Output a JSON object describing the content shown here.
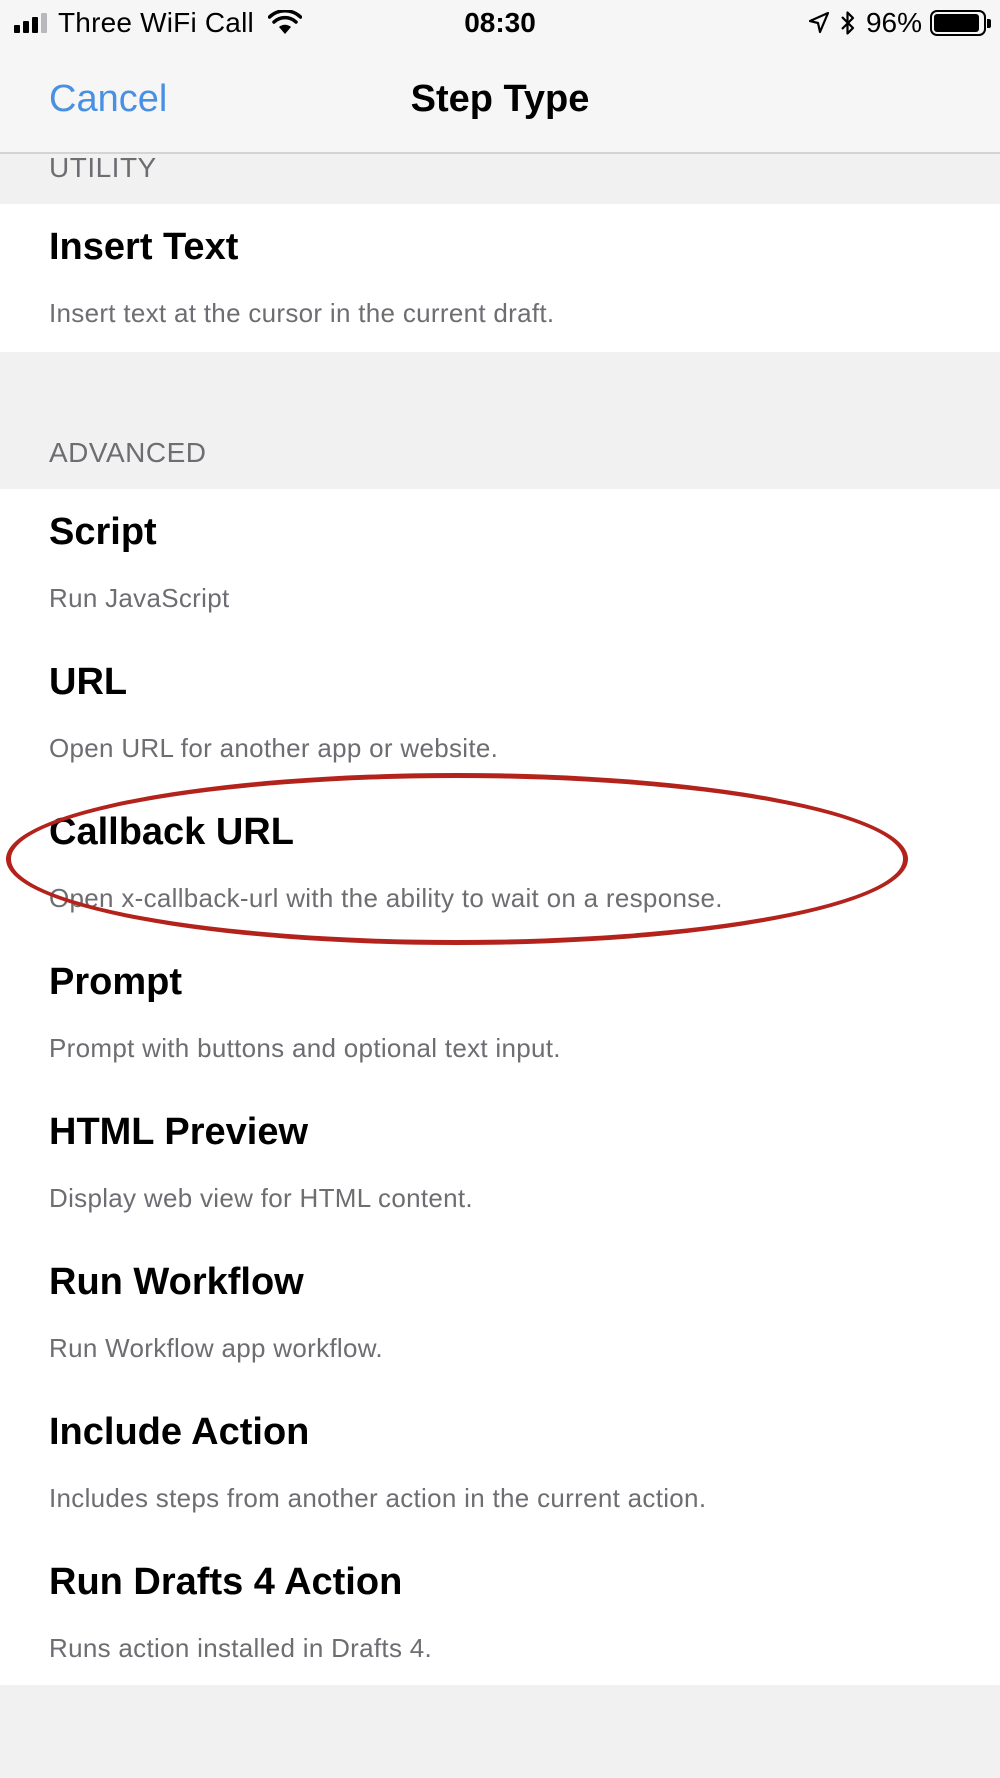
{
  "status_bar": {
    "carrier": "Three WiFi Call",
    "time": "08:30",
    "battery": "96%",
    "battery_level": 0.96,
    "icons": [
      "signal-icon",
      "wifi-icon",
      "location-icon",
      "bluetooth-icon",
      "battery-icon"
    ]
  },
  "nav": {
    "cancel_label": "Cancel",
    "title": "Step Type"
  },
  "sections": {
    "utility": {
      "header": "UTILITY",
      "items": [
        {
          "title": "Insert Text",
          "subtitle": "Insert text at the cursor in the current draft."
        }
      ]
    },
    "advanced": {
      "header": "ADVANCED",
      "items": [
        {
          "title": "Script",
          "subtitle": "Run JavaScript"
        },
        {
          "title": "URL",
          "subtitle": "Open URL for another app or website."
        },
        {
          "title": "Callback URL",
          "subtitle": "Open x-callback-url with the ability to wait on a response."
        },
        {
          "title": "Prompt",
          "subtitle": "Prompt with buttons and optional text input."
        },
        {
          "title": "HTML Preview",
          "subtitle": "Display web view for HTML content."
        },
        {
          "title": "Run Workflow",
          "subtitle": "Run Workflow app workflow."
        },
        {
          "title": "Include Action",
          "subtitle": "Includes steps from another action in the current action."
        },
        {
          "title": "Run Drafts 4 Action",
          "subtitle": "Runs action installed in Drafts 4."
        }
      ]
    }
  },
  "colors": {
    "accent": "#4a90e2",
    "highlight_annotation": "#b3231c",
    "background": "#f1f1f2"
  }
}
